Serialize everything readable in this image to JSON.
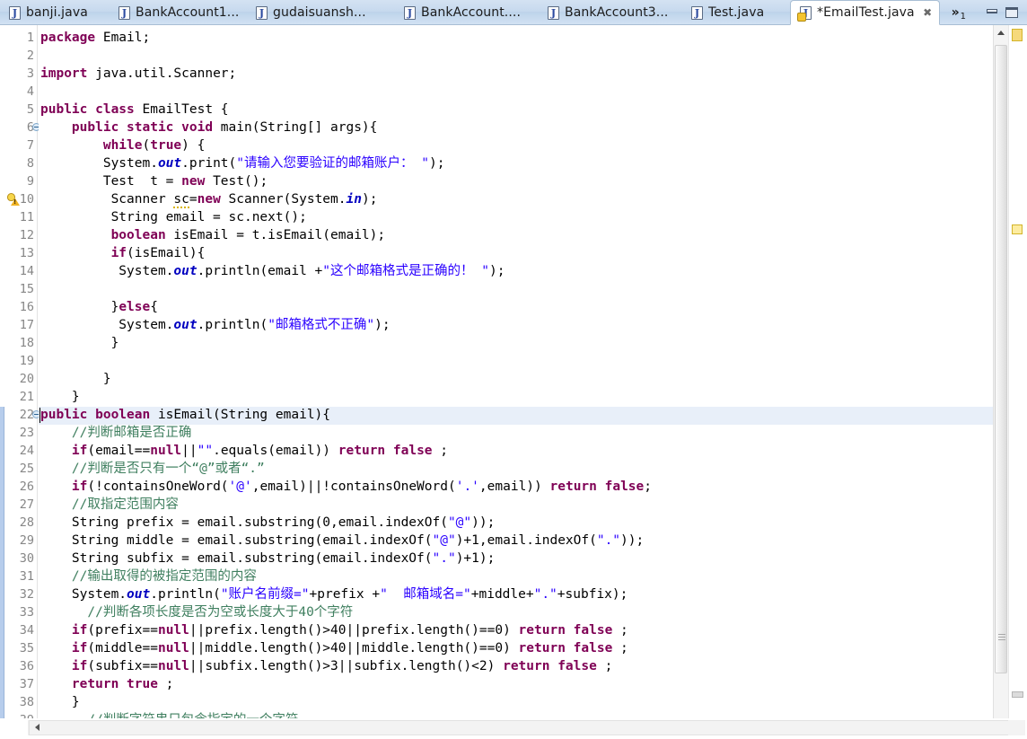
{
  "tabbar": {
    "tabs": [
      {
        "label": "banji.java",
        "icon": "java-file-icon",
        "active": false,
        "dirty": false
      },
      {
        "label": "BankAccount1...",
        "icon": "java-file-icon",
        "active": false,
        "dirty": false
      },
      {
        "label": "gudaisuansh...",
        "icon": "java-file-icon",
        "active": false,
        "dirty": false
      },
      {
        "label": "BankAccount....",
        "icon": "java-file-icon",
        "active": false,
        "dirty": false
      },
      {
        "label": "BankAccount3...",
        "icon": "java-file-icon",
        "active": false,
        "dirty": false
      },
      {
        "label": "Test.java",
        "icon": "java-file-icon",
        "active": false,
        "dirty": false
      },
      {
        "label": "*EmailTest.java",
        "icon": "java-file-locked-icon",
        "active": true,
        "dirty": true
      }
    ],
    "overflow": {
      "chevron": "»",
      "count": "1"
    },
    "window_buttons": [
      {
        "name": "minimize-button",
        "glyph": "minimize"
      },
      {
        "name": "maximize-button",
        "glyph": "maximize"
      }
    ],
    "close_glyph": "✖"
  },
  "editor": {
    "active_line": 22,
    "first_visible_line": 1,
    "last_visible_line": 39,
    "colors": {
      "keyword": "#7f0055",
      "string": "#2a00ff",
      "comment": "#3f7f5f",
      "field": "#0000c0",
      "current_line_highlight": "#e8eff9",
      "change_bar": "#b7cdec",
      "editor_background": "#ffffff"
    },
    "gutter": {
      "fold_markers": [
        6,
        22
      ],
      "warning_markers": [
        10
      ]
    },
    "change_bar_ranges": [
      {
        "from": 22,
        "to": 39
      }
    ],
    "lines": [
      {
        "n": 1,
        "tokens": [
          {
            "t": "kw",
            "v": "package"
          },
          {
            "t": "plain",
            "v": " Email;"
          }
        ]
      },
      {
        "n": 2,
        "tokens": []
      },
      {
        "n": 3,
        "tokens": [
          {
            "t": "kw",
            "v": "import"
          },
          {
            "t": "plain",
            "v": " java.util.Scanner;"
          }
        ]
      },
      {
        "n": 4,
        "tokens": []
      },
      {
        "n": 5,
        "tokens": [
          {
            "t": "kw",
            "v": "public class"
          },
          {
            "t": "plain",
            "v": " EmailTest {"
          }
        ]
      },
      {
        "n": 6,
        "tokens": [
          {
            "t": "plain",
            "v": "    "
          },
          {
            "t": "kw",
            "v": "public static void"
          },
          {
            "t": "plain",
            "v": " main(String[] args){"
          }
        ]
      },
      {
        "n": 7,
        "tokens": [
          {
            "t": "plain",
            "v": "        "
          },
          {
            "t": "kw",
            "v": "while"
          },
          {
            "t": "plain",
            "v": "("
          },
          {
            "t": "kw",
            "v": "true"
          },
          {
            "t": "plain",
            "v": ") {"
          }
        ]
      },
      {
        "n": 8,
        "tokens": [
          {
            "t": "plain",
            "v": "        System."
          },
          {
            "t": "fld",
            "v": "out"
          },
          {
            "t": "plain",
            "v": ".print("
          },
          {
            "t": "str",
            "v": "\"请输入您要验证的邮箱账户： \""
          },
          {
            "t": "plain",
            "v": ");"
          }
        ]
      },
      {
        "n": 9,
        "tokens": [
          {
            "t": "plain",
            "v": "        Test  t = "
          },
          {
            "t": "kw",
            "v": "new"
          },
          {
            "t": "plain",
            "v": " Test();"
          }
        ]
      },
      {
        "n": 10,
        "tokens": [
          {
            "t": "plain",
            "v": "         Scanner "
          },
          {
            "t": "warn",
            "v": "sc"
          },
          {
            "t": "plain",
            "v": "="
          },
          {
            "t": "kw",
            "v": "new"
          },
          {
            "t": "plain",
            "v": " Scanner(System."
          },
          {
            "t": "fld",
            "v": "in"
          },
          {
            "t": "plain",
            "v": ");"
          }
        ]
      },
      {
        "n": 11,
        "tokens": [
          {
            "t": "plain",
            "v": "         String email = sc.next();"
          }
        ]
      },
      {
        "n": 12,
        "tokens": [
          {
            "t": "plain",
            "v": "         "
          },
          {
            "t": "kw",
            "v": "boolean"
          },
          {
            "t": "plain",
            "v": " isEmail = t.isEmail(email);"
          }
        ]
      },
      {
        "n": 13,
        "tokens": [
          {
            "t": "plain",
            "v": "         "
          },
          {
            "t": "kw",
            "v": "if"
          },
          {
            "t": "plain",
            "v": "(isEmail){"
          }
        ]
      },
      {
        "n": 14,
        "tokens": [
          {
            "t": "plain",
            "v": "          System."
          },
          {
            "t": "fld",
            "v": "out"
          },
          {
            "t": "plain",
            "v": ".println(email +"
          },
          {
            "t": "str",
            "v": "\"这个邮箱格式是正确的！ \""
          },
          {
            "t": "plain",
            "v": ");"
          }
        ]
      },
      {
        "n": 15,
        "tokens": []
      },
      {
        "n": 16,
        "tokens": [
          {
            "t": "plain",
            "v": "         }"
          },
          {
            "t": "kw",
            "v": "else"
          },
          {
            "t": "plain",
            "v": "{"
          }
        ]
      },
      {
        "n": 17,
        "tokens": [
          {
            "t": "plain",
            "v": "          System."
          },
          {
            "t": "fld",
            "v": "out"
          },
          {
            "t": "plain",
            "v": ".println("
          },
          {
            "t": "str",
            "v": "\"邮箱格式不正确\""
          },
          {
            "t": "plain",
            "v": ");"
          }
        ]
      },
      {
        "n": 18,
        "tokens": [
          {
            "t": "plain",
            "v": "         }"
          }
        ]
      },
      {
        "n": 19,
        "tokens": []
      },
      {
        "n": 20,
        "tokens": [
          {
            "t": "plain",
            "v": "        }"
          }
        ]
      },
      {
        "n": 21,
        "tokens": [
          {
            "t": "plain",
            "v": "    }"
          }
        ]
      },
      {
        "n": 22,
        "tokens": [
          {
            "t": "kw",
            "v": "public boolean"
          },
          {
            "t": "plain",
            "v": " isEmail(String email){"
          }
        ]
      },
      {
        "n": 23,
        "tokens": [
          {
            "t": "plain",
            "v": "    "
          },
          {
            "t": "cmt",
            "v": "//判断邮箱是否正确"
          }
        ]
      },
      {
        "n": 24,
        "tokens": [
          {
            "t": "plain",
            "v": "    "
          },
          {
            "t": "kw",
            "v": "if"
          },
          {
            "t": "plain",
            "v": "(email=="
          },
          {
            "t": "kw",
            "v": "null"
          },
          {
            "t": "plain",
            "v": "||"
          },
          {
            "t": "str",
            "v": "\"\""
          },
          {
            "t": "plain",
            "v": ".equals(email)) "
          },
          {
            "t": "kw",
            "v": "return false"
          },
          {
            "t": "plain",
            "v": " ;"
          }
        ]
      },
      {
        "n": 25,
        "tokens": [
          {
            "t": "plain",
            "v": "    "
          },
          {
            "t": "cmt",
            "v": "//判断是否只有一个“@”或者“.”"
          }
        ]
      },
      {
        "n": 26,
        "tokens": [
          {
            "t": "plain",
            "v": "    "
          },
          {
            "t": "kw",
            "v": "if"
          },
          {
            "t": "plain",
            "v": "(!containsOneWord("
          },
          {
            "t": "str",
            "v": "'@'"
          },
          {
            "t": "plain",
            "v": ",email)||!containsOneWord("
          },
          {
            "t": "str",
            "v": "'.'"
          },
          {
            "t": "plain",
            "v": ",email)) "
          },
          {
            "t": "kw",
            "v": "return false"
          },
          {
            "t": "plain",
            "v": ";"
          }
        ]
      },
      {
        "n": 27,
        "tokens": [
          {
            "t": "plain",
            "v": "    "
          },
          {
            "t": "cmt",
            "v": "//取指定范围内容"
          }
        ]
      },
      {
        "n": 28,
        "tokens": [
          {
            "t": "plain",
            "v": "    String prefix = email.substring(0,email.indexOf("
          },
          {
            "t": "str",
            "v": "\"@\""
          },
          {
            "t": "plain",
            "v": "));"
          }
        ]
      },
      {
        "n": 29,
        "tokens": [
          {
            "t": "plain",
            "v": "    String middle = email.substring(email.indexOf("
          },
          {
            "t": "str",
            "v": "\"@\""
          },
          {
            "t": "plain",
            "v": ")+1,email.indexOf("
          },
          {
            "t": "str",
            "v": "\".\""
          },
          {
            "t": "plain",
            "v": "));"
          }
        ]
      },
      {
        "n": 30,
        "tokens": [
          {
            "t": "plain",
            "v": "    String subfix = email.substring(email.indexOf("
          },
          {
            "t": "str",
            "v": "\".\""
          },
          {
            "t": "plain",
            "v": ")+1);"
          }
        ]
      },
      {
        "n": 31,
        "tokens": [
          {
            "t": "plain",
            "v": "    "
          },
          {
            "t": "cmt",
            "v": "//输出取得的被指定范围的内容"
          }
        ]
      },
      {
        "n": 32,
        "tokens": [
          {
            "t": "plain",
            "v": "    System."
          },
          {
            "t": "fld",
            "v": "out"
          },
          {
            "t": "plain",
            "v": ".println("
          },
          {
            "t": "str",
            "v": "\"账户名前缀=\""
          },
          {
            "t": "plain",
            "v": "+prefix +"
          },
          {
            "t": "str",
            "v": "\"  邮箱域名=\""
          },
          {
            "t": "plain",
            "v": "+middle+"
          },
          {
            "t": "str",
            "v": "\".\""
          },
          {
            "t": "plain",
            "v": "+subfix);"
          }
        ]
      },
      {
        "n": 33,
        "tokens": [
          {
            "t": "plain",
            "v": "      "
          },
          {
            "t": "cmt",
            "v": "//判断各项长度是否为空或长度大于40个字符"
          }
        ]
      },
      {
        "n": 34,
        "tokens": [
          {
            "t": "plain",
            "v": "    "
          },
          {
            "t": "kw",
            "v": "if"
          },
          {
            "t": "plain",
            "v": "(prefix=="
          },
          {
            "t": "kw",
            "v": "null"
          },
          {
            "t": "plain",
            "v": "||prefix.length()>40||prefix.length()==0) "
          },
          {
            "t": "kw",
            "v": "return false"
          },
          {
            "t": "plain",
            "v": " ;"
          }
        ]
      },
      {
        "n": 35,
        "tokens": [
          {
            "t": "plain",
            "v": "    "
          },
          {
            "t": "kw",
            "v": "if"
          },
          {
            "t": "plain",
            "v": "(middle=="
          },
          {
            "t": "kw",
            "v": "null"
          },
          {
            "t": "plain",
            "v": "||middle.length()>40||middle.length()==0) "
          },
          {
            "t": "kw",
            "v": "return false"
          },
          {
            "t": "plain",
            "v": " ;"
          }
        ]
      },
      {
        "n": 36,
        "tokens": [
          {
            "t": "plain",
            "v": "    "
          },
          {
            "t": "kw",
            "v": "if"
          },
          {
            "t": "plain",
            "v": "(subfix=="
          },
          {
            "t": "kw",
            "v": "null"
          },
          {
            "t": "plain",
            "v": "||subfix.length()>3||subfix.length()<2) "
          },
          {
            "t": "kw",
            "v": "return false"
          },
          {
            "t": "plain",
            "v": " ;"
          }
        ]
      },
      {
        "n": 37,
        "tokens": [
          {
            "t": "plain",
            "v": "    "
          },
          {
            "t": "kw",
            "v": "return true"
          },
          {
            "t": "plain",
            "v": " ;"
          }
        ]
      },
      {
        "n": 38,
        "tokens": [
          {
            "t": "plain",
            "v": "    }"
          }
        ]
      },
      {
        "n": 39,
        "tokens": [
          {
            "t": "plain",
            "v": "      "
          },
          {
            "t": "cmt",
            "v": "//判断字符串只包含指定的一个字符"
          }
        ]
      }
    ]
  },
  "scrollbars": {
    "vertical": {
      "name": "vertical-scrollbar",
      "up_arrow": "▲"
    },
    "horizontal": {
      "name": "horizontal-scrollbar",
      "left_arrow": "◀",
      "right_arrow": "▶"
    },
    "overview_ruler": {
      "markers": [
        "warning",
        "warning",
        "info"
      ]
    }
  }
}
